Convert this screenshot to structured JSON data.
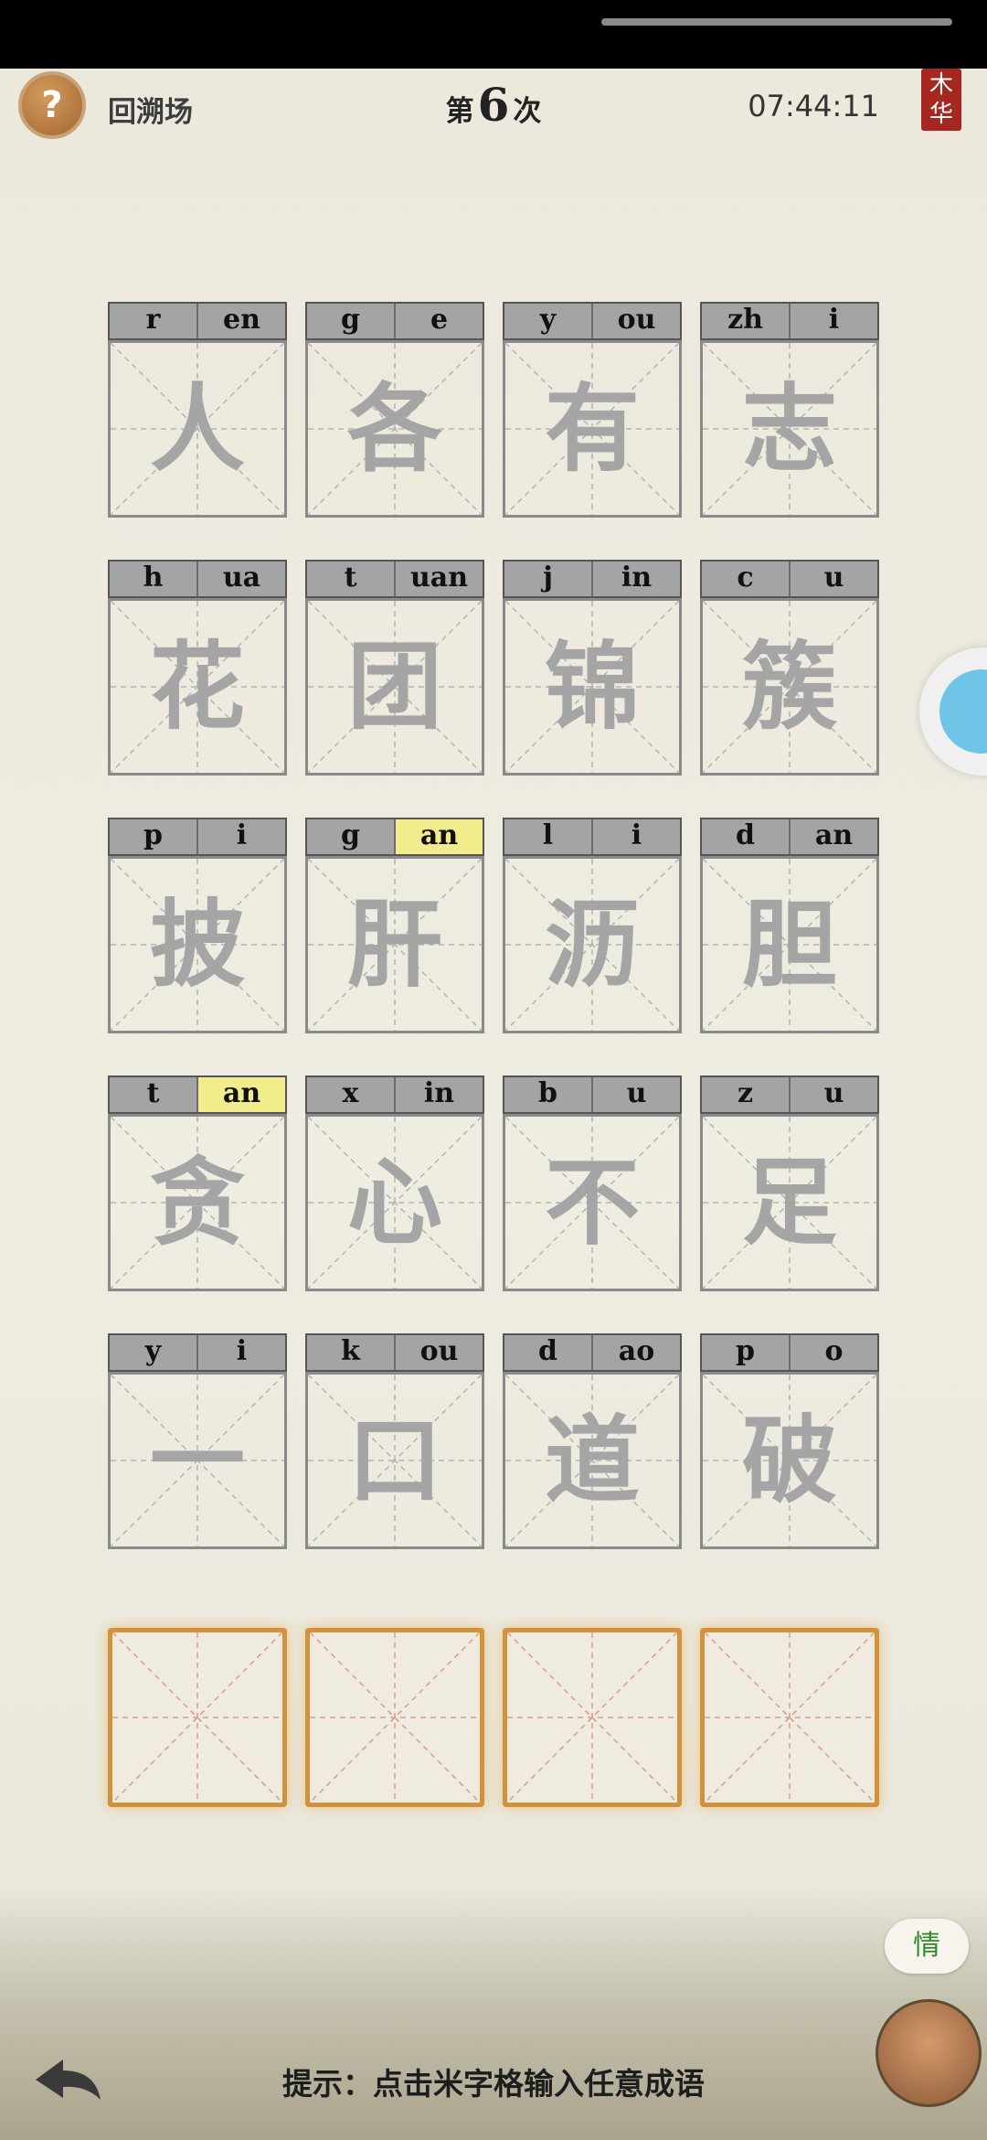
{
  "header": {
    "help_icon_text": "?",
    "mode_label": "回溯场",
    "round_prefix": "第",
    "round_number": "6",
    "round_suffix": "次",
    "timer": "07:44:11",
    "seal_text": [
      "木",
      "华"
    ]
  },
  "idioms": [
    [
      {
        "initial": "r",
        "final": "en",
        "char": "人"
      },
      {
        "initial": "g",
        "final": "e",
        "char": "各"
      },
      {
        "initial": "y",
        "final": "ou",
        "char": "有"
      },
      {
        "initial": "zh",
        "final": "i",
        "char": "志"
      }
    ],
    [
      {
        "initial": "h",
        "final": "ua",
        "char": "花"
      },
      {
        "initial": "t",
        "final": "uan",
        "char": "团"
      },
      {
        "initial": "j",
        "final": "in",
        "char": "锦"
      },
      {
        "initial": "c",
        "final": "u",
        "char": "簇"
      }
    ],
    [
      {
        "initial": "p",
        "final": "i",
        "char": "披"
      },
      {
        "initial": "g",
        "final": "an",
        "char": "肝",
        "final_highlight": true
      },
      {
        "initial": "l",
        "final": "i",
        "char": "沥"
      },
      {
        "initial": "d",
        "final": "an",
        "char": "胆"
      }
    ],
    [
      {
        "initial": "t",
        "final": "an",
        "char": "贪",
        "final_highlight": true
      },
      {
        "initial": "x",
        "final": "in",
        "char": "心"
      },
      {
        "initial": "b",
        "final": "u",
        "char": "不"
      },
      {
        "initial": "z",
        "final": "u",
        "char": "足"
      }
    ],
    [
      {
        "initial": "y",
        "final": "i",
        "char": "一"
      },
      {
        "initial": "k",
        "final": "ou",
        "char": "口"
      },
      {
        "initial": "d",
        "final": "ao",
        "char": "道"
      },
      {
        "initial": "p",
        "final": "o",
        "char": "破"
      }
    ]
  ],
  "answer_slots": 4,
  "footer": {
    "hint": "提示：点击米字格输入任意成语",
    "bubble_text": "情"
  },
  "colors": {
    "highlight": "#f1ec8c",
    "answer_border": "#d2923c",
    "seal": "#a52720"
  }
}
